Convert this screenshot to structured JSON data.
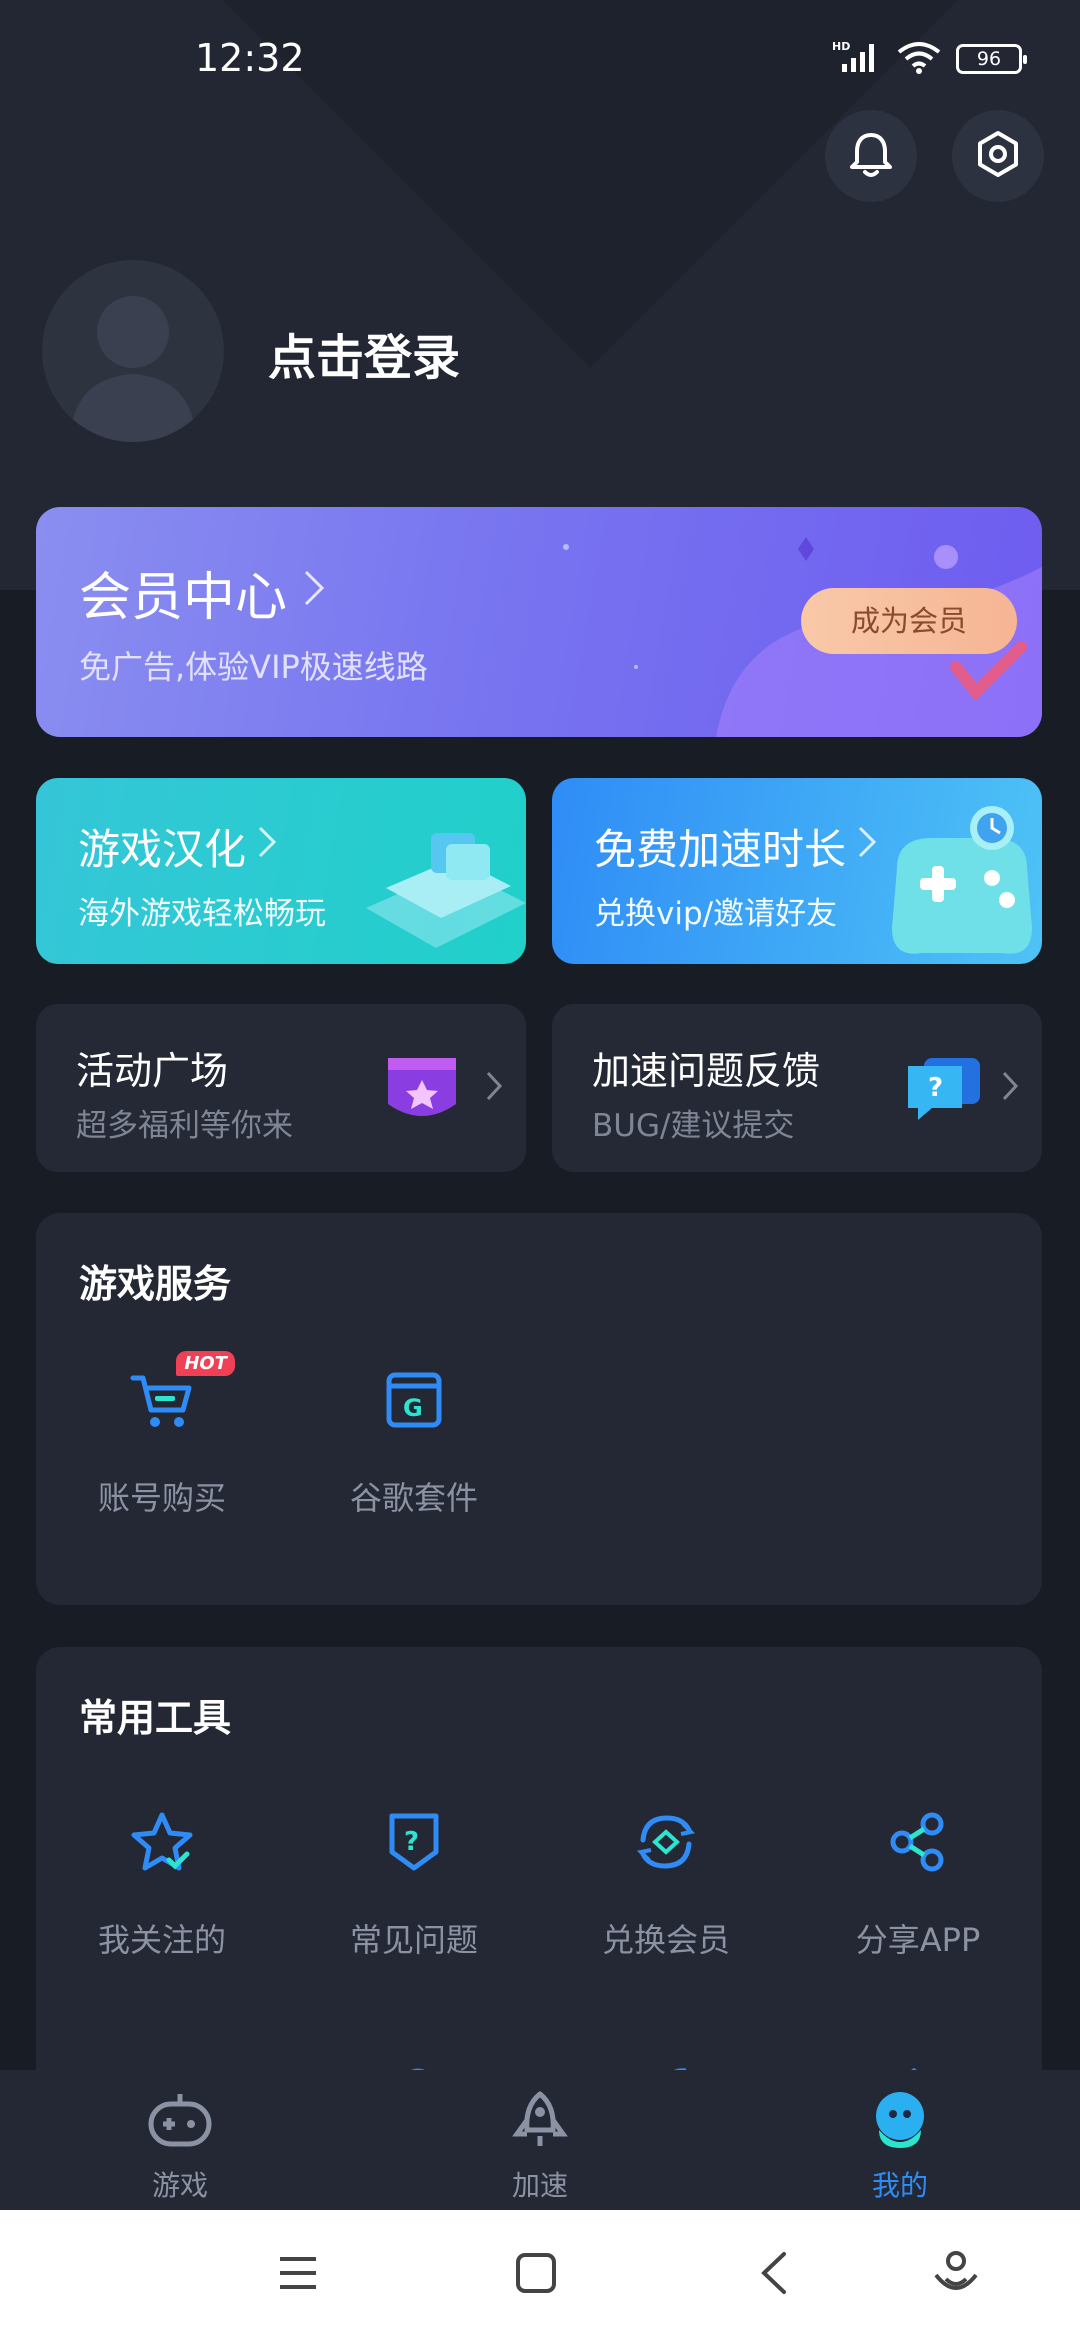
{
  "status_bar": {
    "time": "12:32",
    "battery": "96",
    "network": "HD"
  },
  "header": {
    "login_text": "点击登录"
  },
  "vip": {
    "title": "会员中心",
    "subtitle": "免广告,体验VIP极速线路",
    "button": "成为会员"
  },
  "promo_cards": [
    {
      "title": "游戏汉化",
      "subtitle": "海外游戏轻松畅玩"
    },
    {
      "title": "免费加速时长",
      "subtitle": "兑换vip/邀请好友"
    }
  ],
  "info_cards": [
    {
      "title": "活动广场",
      "subtitle": "超多福利等你来"
    },
    {
      "title": "加速问题反馈",
      "subtitle": "BUG/建议提交"
    }
  ],
  "game_services": {
    "title": "游戏服务",
    "items": [
      {
        "label": "账号购买",
        "badge": "HOT",
        "icon": "cart-icon"
      },
      {
        "label": "谷歌套件",
        "icon": "google-suite-icon"
      }
    ]
  },
  "tools": {
    "title": "常用工具",
    "items": [
      {
        "label": "我关注的",
        "icon": "star-icon"
      },
      {
        "label": "常见问题",
        "icon": "faq-icon"
      },
      {
        "label": "兑换会员",
        "icon": "exchange-icon"
      },
      {
        "label": "分享APP",
        "icon": "share-icon"
      }
    ]
  },
  "bottom_nav": {
    "items": [
      {
        "label": "游戏",
        "icon": "gamepad-icon"
      },
      {
        "label": "加速",
        "icon": "rocket-icon"
      },
      {
        "label": "我的",
        "icon": "profile-mascot-icon",
        "active": true
      }
    ]
  },
  "colors": {
    "accent": "#2f8cf6",
    "background": "#181c25",
    "card": "#232834",
    "vip_button": "#f8c9a8"
  }
}
